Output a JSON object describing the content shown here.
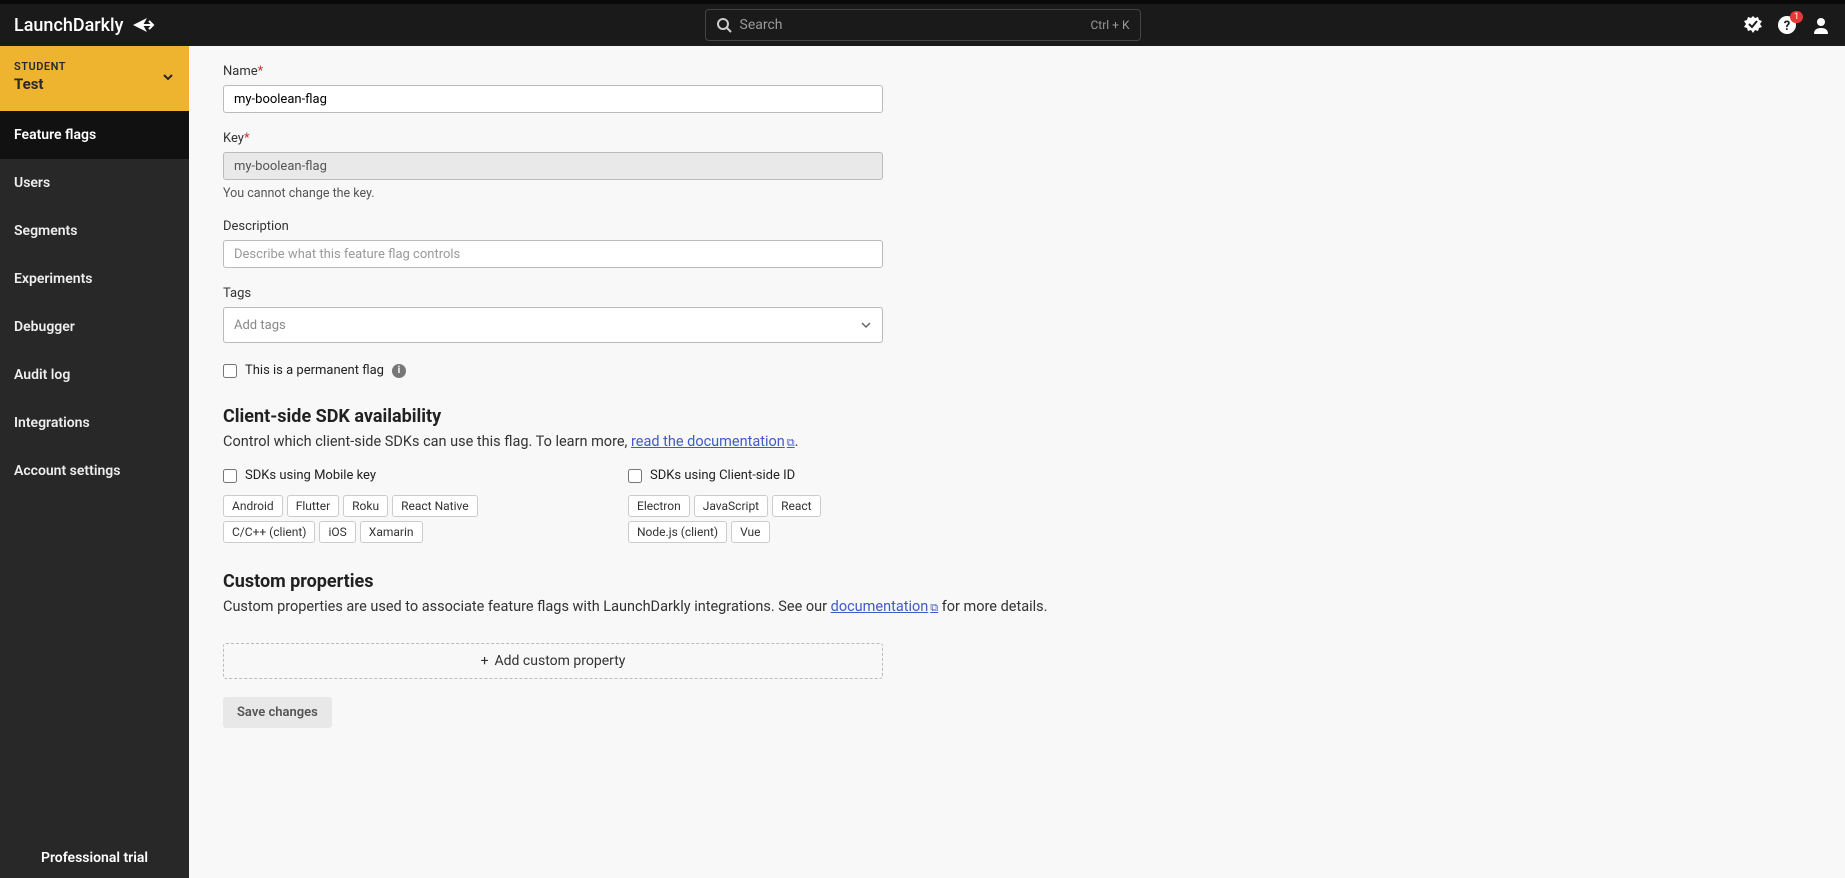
{
  "header": {
    "logo_text": "LaunchDarkly",
    "search_placeholder": "Search",
    "search_shortcut": "Ctrl + K",
    "help_badge": "1"
  },
  "project": {
    "label": "STUDENT",
    "name": "Test"
  },
  "nav": {
    "items": [
      "Feature flags",
      "Users",
      "Segments",
      "Experiments",
      "Debugger",
      "Audit log",
      "Integrations",
      "Account settings"
    ]
  },
  "sidebar_footer": "Professional trial",
  "form": {
    "name_label": "Name",
    "name_value": "my-boolean-flag",
    "key_label": "Key",
    "key_value": "my-boolean-flag",
    "key_help": "You cannot change the key.",
    "description_label": "Description",
    "description_placeholder": "Describe what this feature flag controls",
    "tags_label": "Tags",
    "tags_placeholder": "Add tags",
    "permanent_label": "This is a permanent flag"
  },
  "sdk_section": {
    "title": "Client-side SDK availability",
    "desc_prefix": "Control which client-side SDKs can use this flag. To learn more, ",
    "desc_link": "read the documentation",
    "desc_suffix": ".",
    "mobile_label": "SDKs using Mobile key",
    "mobile_tags": [
      "Android",
      "Flutter",
      "Roku",
      "React Native",
      "C/C++ (client)",
      "iOS",
      "Xamarin"
    ],
    "client_label": "SDKs using Client-side ID",
    "client_tags": [
      "Electron",
      "JavaScript",
      "React",
      "Node.js (client)",
      "Vue"
    ]
  },
  "custom_props": {
    "title": "Custom properties",
    "desc_prefix": "Custom properties are used to associate feature flags with LaunchDarkly integrations. See our ",
    "desc_link": "documentation",
    "desc_suffix": " for more details.",
    "add_label": "Add custom property"
  },
  "save_label": "Save changes"
}
